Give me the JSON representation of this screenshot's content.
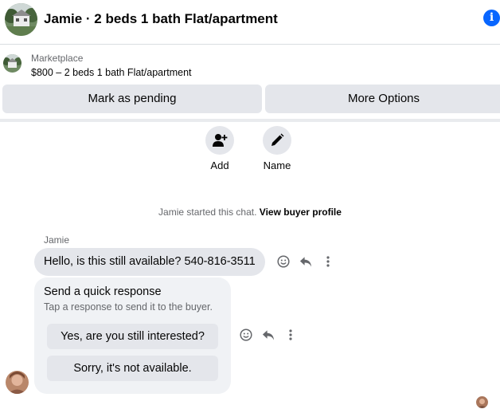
{
  "header": {
    "title": "Jamie · 2 beds 1 bath Flat/apartment",
    "info_icon": "info-icon",
    "info_glyph": "i",
    "info_color": "#0866ff"
  },
  "listing": {
    "source": "Marketplace",
    "price_line": "$800 – 2 beds 1 bath Flat/apartment"
  },
  "actions": {
    "mark_pending": "Mark as pending",
    "more_options": "More Options"
  },
  "quick_actions": [
    {
      "label": "Add",
      "icon": "add-person-icon"
    },
    {
      "label": "Name",
      "icon": "pencil-icon"
    }
  ],
  "chat": {
    "started_text": "Jamie started this chat.",
    "buyer_profile_link": "View buyer profile",
    "sender_name": "Jamie",
    "message": "Hello, is this still available? 540-816-3511"
  },
  "quick_response": {
    "title": "Send a quick response",
    "subtitle": "Tap a response to send it to the buyer.",
    "options": [
      "Yes, are you still interested?",
      "Sorry, it's not available."
    ]
  },
  "colors": {
    "accent": "#0866ff",
    "button_bg": "#e4e6eb",
    "secondary_text": "#65676b",
    "card_bg": "#f0f2f5"
  }
}
